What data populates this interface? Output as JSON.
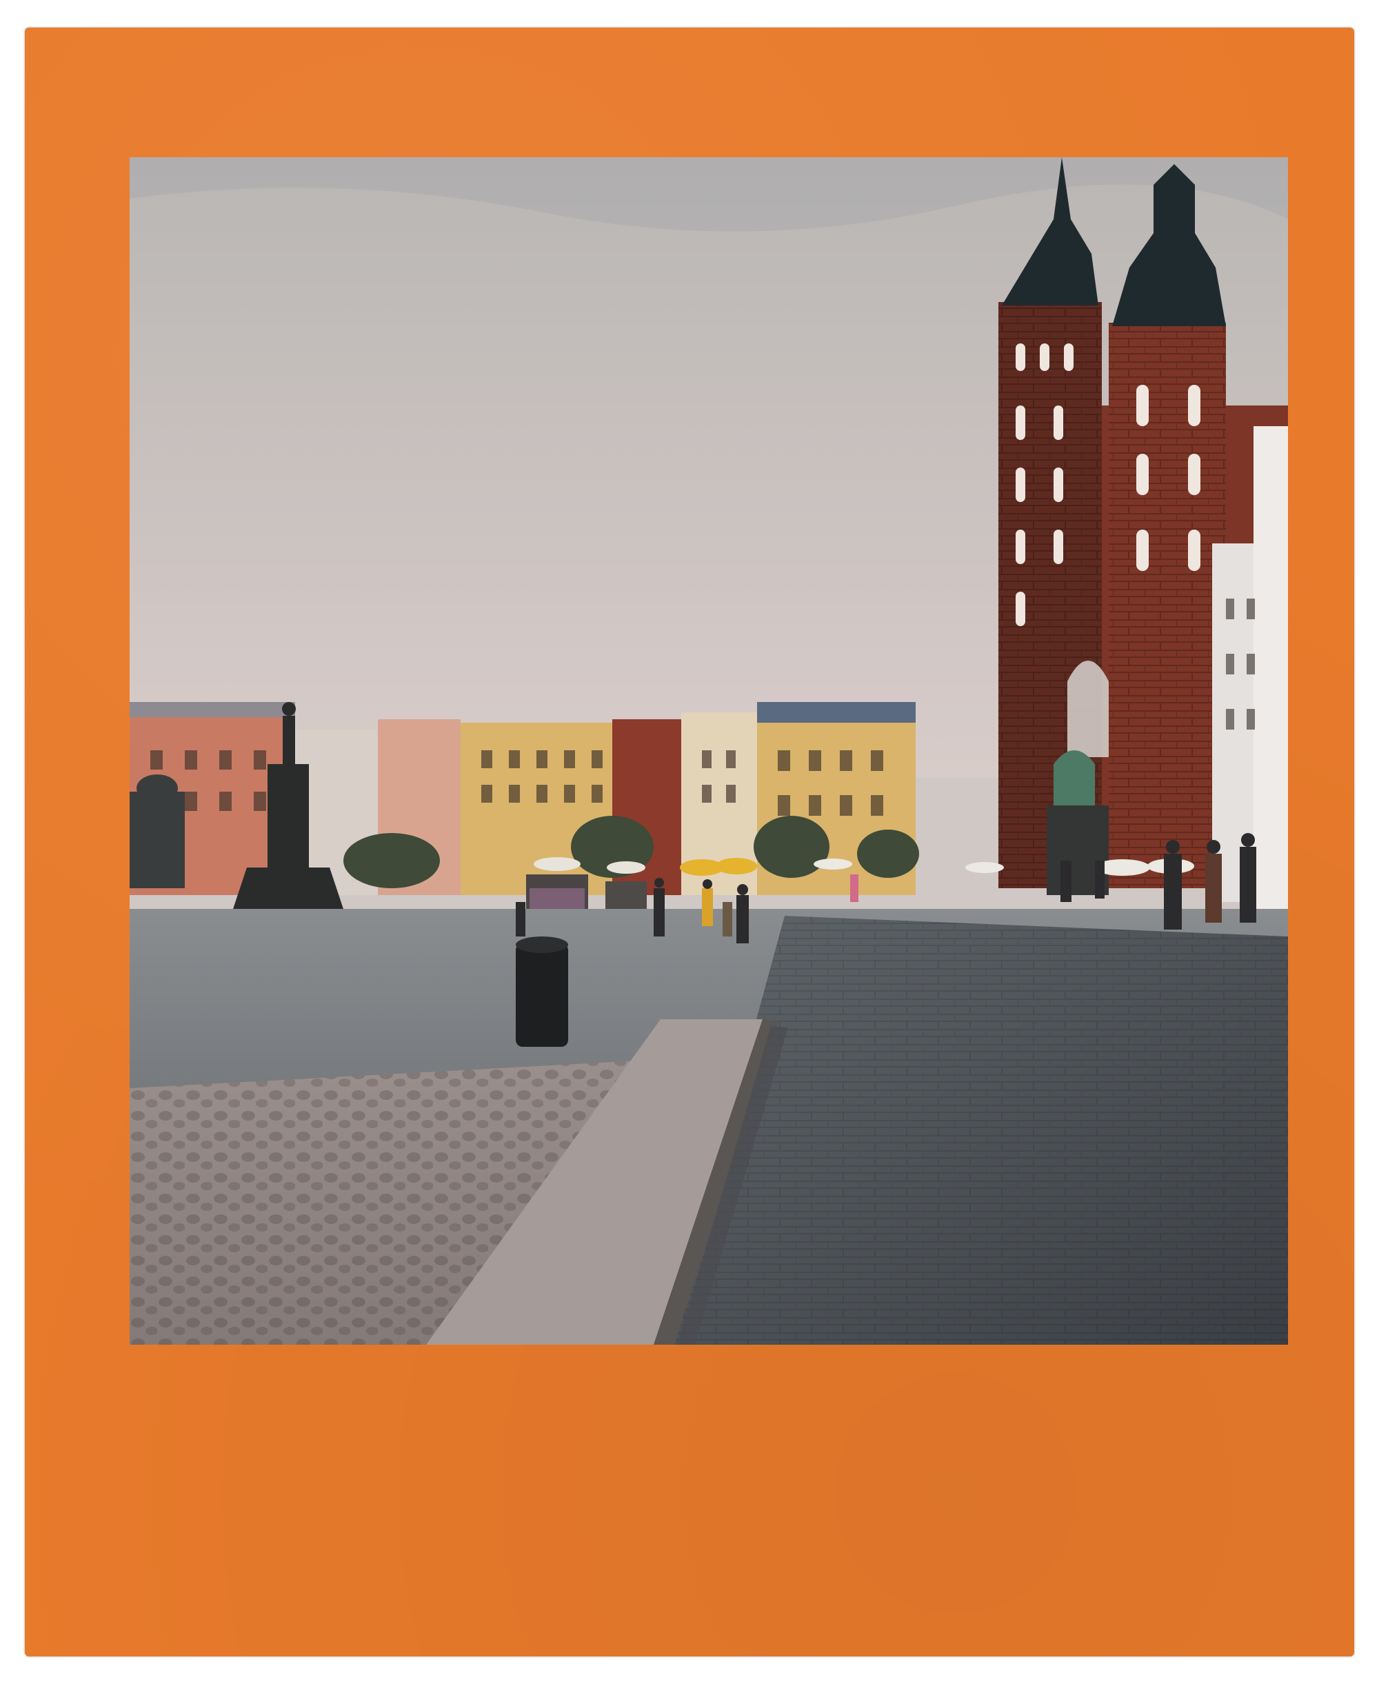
{
  "frame": {
    "color": "#e87a2b",
    "style": "instant-film-border"
  },
  "photo": {
    "scene": "old-town-market-square",
    "palette": {
      "sky_top": "#b9b6b4",
      "sky_bottom": "#d8ccc9",
      "brick": "#7c3526",
      "brick_dark": "#5e2a20",
      "roof": "#1f2a2e",
      "paving": "#6f7478",
      "paving_dark": "#3e4246",
      "facade_yellow": "#d9b46a",
      "facade_cream": "#e3d4b8",
      "facade_pink": "#d9a48f",
      "facade_salmon": "#c97a63",
      "umbrella": "#e6b32e"
    }
  }
}
